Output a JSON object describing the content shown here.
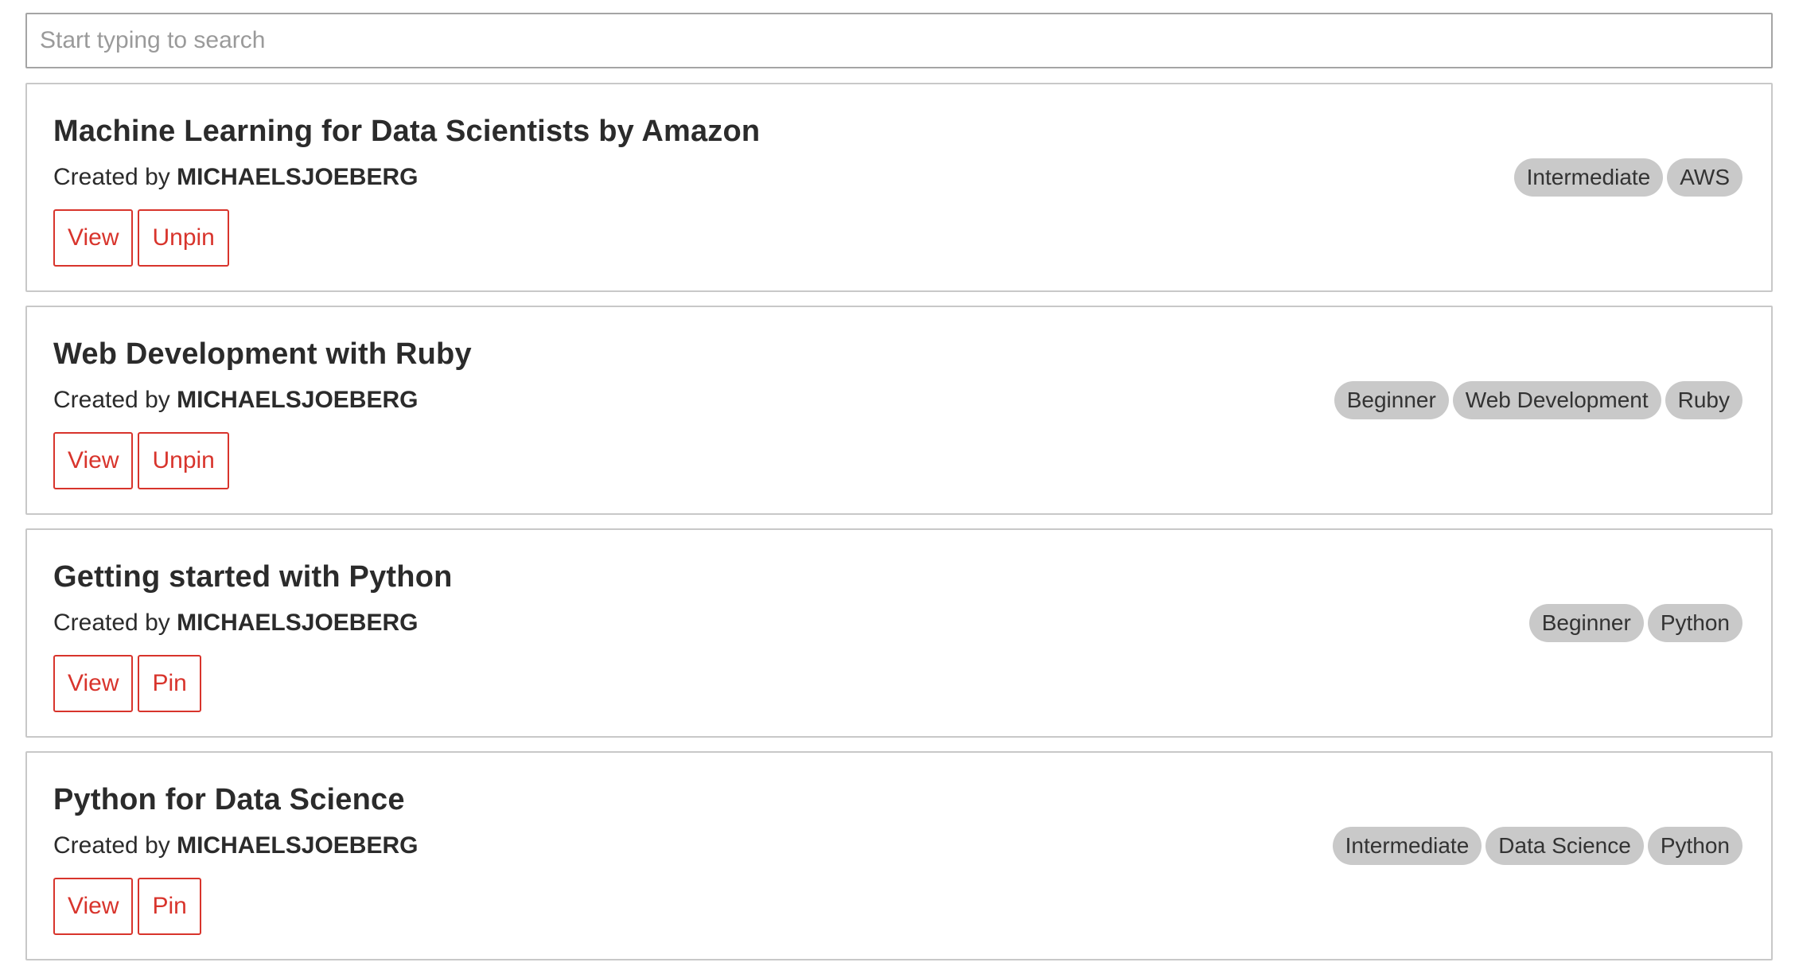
{
  "search": {
    "placeholder": "Start typing to search",
    "value": ""
  },
  "courses": [
    {
      "title": "Machine Learning for Data Scientists by Amazon",
      "created_by_label": "Created by ",
      "author": "MICHAELSJOEBERG",
      "view_label": "View",
      "pin_label": "Unpin",
      "tags": [
        "Intermediate",
        "AWS"
      ]
    },
    {
      "title": "Web Development with Ruby",
      "created_by_label": "Created by ",
      "author": "MICHAELSJOEBERG",
      "view_label": "View",
      "pin_label": "Unpin",
      "tags": [
        "Beginner",
        "Web Development",
        "Ruby"
      ]
    },
    {
      "title": "Getting started with Python",
      "created_by_label": "Created by ",
      "author": "MICHAELSJOEBERG",
      "view_label": "View",
      "pin_label": "Pin",
      "tags": [
        "Beginner",
        "Python"
      ]
    },
    {
      "title": "Python for Data Science",
      "created_by_label": "Created by ",
      "author": "MICHAELSJOEBERG",
      "view_label": "View",
      "pin_label": "Pin",
      "tags": [
        "Intermediate",
        "Data Science",
        "Python"
      ]
    }
  ],
  "colors": {
    "accent": "#d8342c",
    "tag_background": "#c9c9c9",
    "card_border": "#c8c8c8"
  }
}
